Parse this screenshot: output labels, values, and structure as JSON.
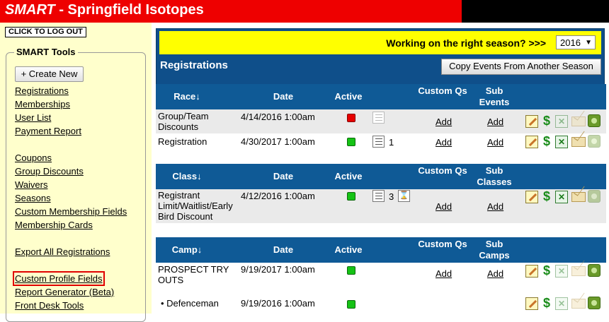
{
  "header": {
    "brand": "SMART",
    "title_rest": "- Springfield Isotopes"
  },
  "sidebar": {
    "logout_label": "CLICK TO LOG OUT",
    "tools_heading": "SMART Tools",
    "create_new_label": "+ Create New",
    "links": [
      "Registrations",
      "Memberships",
      "User List",
      "Payment Report",
      "Coupons",
      "Group Discounts",
      "Waivers",
      "Seasons",
      "Custom Membership Fields",
      "Membership Cards",
      "Export All Registrations",
      "Custom Profile Fields",
      "Report Generator",
      "Front Desk Tools"
    ],
    "beta_suffix": "(Beta)"
  },
  "season_panel": {
    "question": "Working on the right season? >>>",
    "season_selected": "2016",
    "section_title": "Registrations",
    "copy_button": "Copy Events From Another Season"
  },
  "sections": [
    {
      "headers": {
        "name": "Race↓",
        "date": "Date",
        "active": "Active",
        "custom": "Custom Qs",
        "sub": "Sub Events"
      },
      "rows": [
        {
          "name": "Group/Team Discounts",
          "date": "4/14/2016 1:00am",
          "active": "red",
          "count": "",
          "custom": "Add",
          "sub": "Add"
        },
        {
          "name": "Registration",
          "date": "4/30/2017 1:00am",
          "active": "green",
          "count": "1",
          "custom": "Add",
          "sub": "Add"
        }
      ]
    },
    {
      "headers": {
        "name": "Class↓",
        "date": "Date",
        "active": "Active",
        "custom": "Custom Qs",
        "sub": "Sub Classes"
      },
      "rows": [
        {
          "name": "Registrant Limit/Waitlist/Early Bird Discount",
          "date": "4/12/2016 1:00am",
          "active": "green",
          "count": "3",
          "custom": "Add",
          "sub": "Add"
        }
      ]
    },
    {
      "headers": {
        "name": "Camp↓",
        "date": "Date",
        "active": "Active",
        "custom": "Custom Qs",
        "sub": "Sub Camps"
      },
      "rows": [
        {
          "name": "PROSPECT TRY OUTS",
          "date": "9/19/2017 1:00am",
          "active": "green",
          "count": "",
          "custom": "Add",
          "sub": "Add"
        },
        {
          "name": "• Defenceman",
          "date": "9/19/2016 1:00am",
          "active": "green",
          "count": "",
          "custom": "",
          "sub": ""
        }
      ]
    }
  ]
}
